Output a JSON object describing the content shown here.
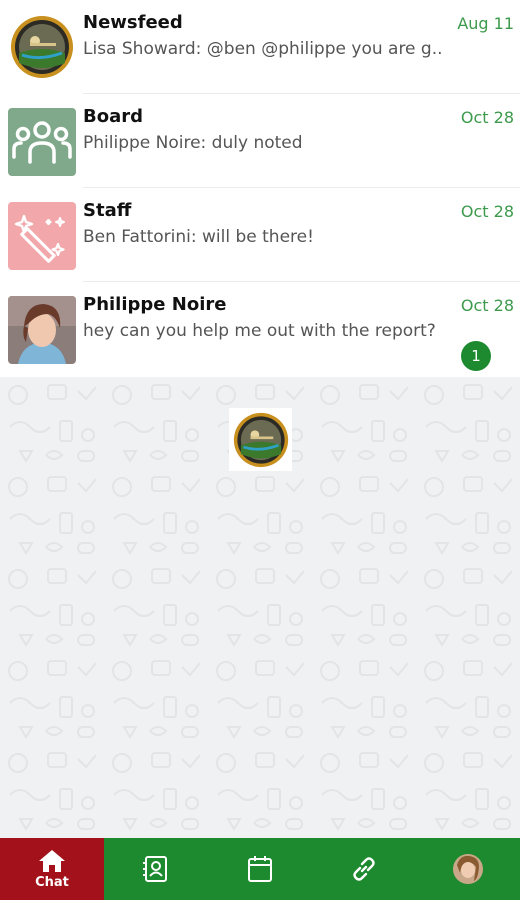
{
  "colors": {
    "accent_green": "#1e8a30",
    "date_green": "#3d9a4c",
    "nav_active": "#a3121a",
    "board_tile": "#7fa98a",
    "staff_tile": "#f2a8ab"
  },
  "chats": [
    {
      "name": "Newsfeed",
      "preview": "Lisa Showard: @ben @philippe you are g...",
      "date": "Aug 11",
      "avatar": "club-logo"
    },
    {
      "name": "Board",
      "preview": "Philippe Noire: duly noted",
      "date": "Oct 28",
      "avatar": "group-icon"
    },
    {
      "name": "Staff",
      "preview": "Ben Fattorini: will be there!",
      "date": "Oct 28",
      "avatar": "magic-wand-icon"
    },
    {
      "name": "Philippe Noire",
      "preview": "hey can you help me out with the report?",
      "date": "Oct 28",
      "avatar": "profile-photo",
      "unread": "1"
    }
  ],
  "nav": {
    "chat_label": "Chat",
    "items": [
      "home-icon",
      "contacts-icon",
      "calendar-icon",
      "link-icon",
      "profile-avatar"
    ]
  }
}
